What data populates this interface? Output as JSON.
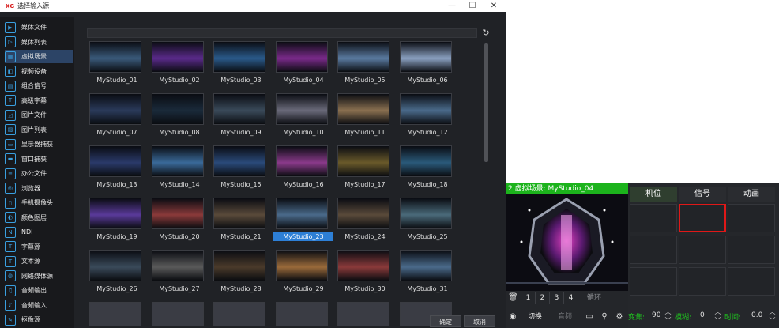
{
  "dialog": {
    "logo": "XG",
    "title": "选择输入源",
    "window_buttons": {
      "minimize": "—",
      "maximize": "☐",
      "close": "✕"
    },
    "confirm_label": "确定",
    "cancel_label": "取消"
  },
  "sidebar": {
    "items": [
      {
        "label": "媒体文件",
        "icon": "play-file-icon",
        "glyph": "▶"
      },
      {
        "label": "媒体列表",
        "icon": "media-list-icon",
        "glyph": "▷"
      },
      {
        "label": "虚拟场景",
        "icon": "virtual-scene-icon",
        "glyph": "▦",
        "active": true
      },
      {
        "label": "视频设备",
        "icon": "video-device-icon",
        "glyph": "◧"
      },
      {
        "label": "组合信号",
        "icon": "combined-signal-icon",
        "glyph": "▤"
      },
      {
        "label": "高级字幕",
        "icon": "advanced-caption-icon",
        "glyph": "T"
      },
      {
        "label": "图片文件",
        "icon": "image-file-icon",
        "glyph": "◿"
      },
      {
        "label": "图片列表",
        "icon": "image-list-icon",
        "glyph": "▨"
      },
      {
        "label": "显示器捕获",
        "icon": "monitor-capture-icon",
        "glyph": "▭"
      },
      {
        "label": "窗口捕获",
        "icon": "window-capture-icon",
        "glyph": "▬"
      },
      {
        "label": "办公文件",
        "icon": "office-file-icon",
        "glyph": "≡"
      },
      {
        "label": "浏览器",
        "icon": "browser-icon",
        "glyph": "◎"
      },
      {
        "label": "手机摄像头",
        "icon": "phone-camera-icon",
        "glyph": "▯"
      },
      {
        "label": "颜色图层",
        "icon": "color-layer-icon",
        "glyph": "◐"
      },
      {
        "label": "NDI",
        "icon": "ndi-icon",
        "glyph": "N"
      },
      {
        "label": "字幕源",
        "icon": "caption-source-icon",
        "glyph": "T"
      },
      {
        "label": "文本源",
        "icon": "text-source-icon",
        "glyph": "T"
      },
      {
        "label": "网络媒体源",
        "icon": "network-media-icon",
        "glyph": "◍"
      },
      {
        "label": "音频输出",
        "icon": "audio-output-icon",
        "glyph": "♫"
      },
      {
        "label": "音频输入",
        "icon": "microphone-icon",
        "glyph": "♪"
      },
      {
        "label": "抠像源",
        "icon": "keying-source-icon",
        "glyph": "✎"
      }
    ]
  },
  "studios": [
    {
      "name": "MyStudio_01",
      "color": "#3a5a7a"
    },
    {
      "name": "MyStudio_02",
      "color": "#5a2a8a"
    },
    {
      "name": "MyStudio_03",
      "color": "#2a5a8a"
    },
    {
      "name": "MyStudio_04",
      "color": "#7a2a8a"
    },
    {
      "name": "MyStudio_05",
      "color": "#5a7aa0"
    },
    {
      "name": "MyStudio_06",
      "color": "#8aa0c0"
    },
    {
      "name": "MyStudio_07",
      "color": "#2a3a5a"
    },
    {
      "name": "MyStudio_08",
      "color": "#1a2a3a"
    },
    {
      "name": "MyStudio_09",
      "color": "#3a4a5a"
    },
    {
      "name": "MyStudio_10",
      "color": "#6a6a7a"
    },
    {
      "name": "MyStudio_11",
      "color": "#8a7050"
    },
    {
      "name": "MyStudio_12",
      "color": "#4a6a8a"
    },
    {
      "name": "MyStudio_13",
      "color": "#2a3a6a"
    },
    {
      "name": "MyStudio_14",
      "color": "#3a6a9a"
    },
    {
      "name": "MyStudio_15",
      "color": "#2a4a7a"
    },
    {
      "name": "MyStudio_16",
      "color": "#8a3a8a"
    },
    {
      "name": "MyStudio_17",
      "color": "#6a5a2a"
    },
    {
      "name": "MyStudio_18",
      "color": "#2a5a7a"
    },
    {
      "name": "MyStudio_19",
      "color": "#5a3a9a"
    },
    {
      "name": "MyStudio_20",
      "color": "#8a3a3a"
    },
    {
      "name": "MyStudio_21",
      "color": "#5a4a3a"
    },
    {
      "name": "MyStudio_23",
      "color": "#4a6a8a",
      "selected": true
    },
    {
      "name": "MyStudio_24",
      "color": "#5a4a3a"
    },
    {
      "name": "MyStudio_25",
      "color": "#4a6a7a"
    },
    {
      "name": "MyStudio_26",
      "color": "#3a4a5a"
    },
    {
      "name": "MyStudio_27",
      "color": "#5a5a5a"
    },
    {
      "name": "MyStudio_28",
      "color": "#4a3a2a"
    },
    {
      "name": "MyStudio_29",
      "color": "#9a6a3a"
    },
    {
      "name": "MyStudio_30",
      "color": "#8a3a3a"
    },
    {
      "name": "MyStudio_31",
      "color": "#4a6a8a"
    }
  ],
  "preview": {
    "header": "2 虚拟场景: MyStudio_04",
    "number_tabs": [
      "1",
      "2",
      "3",
      "4"
    ],
    "loop_label": "循环",
    "switch_label": "切换",
    "audio_label": "音频"
  },
  "panel": {
    "tabs": [
      "机位",
      "信号",
      "动画"
    ],
    "zoom_label": "变焦:",
    "zoom_value": "90",
    "blur_label": "模糊:",
    "blur_value": "0",
    "time_label": "时间:",
    "time_value": "0.0"
  },
  "colors": {
    "accent_green": "#1cb31c",
    "selection_blue": "#2d7fd6",
    "highlight_red": "#e01818",
    "active_tab": "#2f3e2f"
  }
}
